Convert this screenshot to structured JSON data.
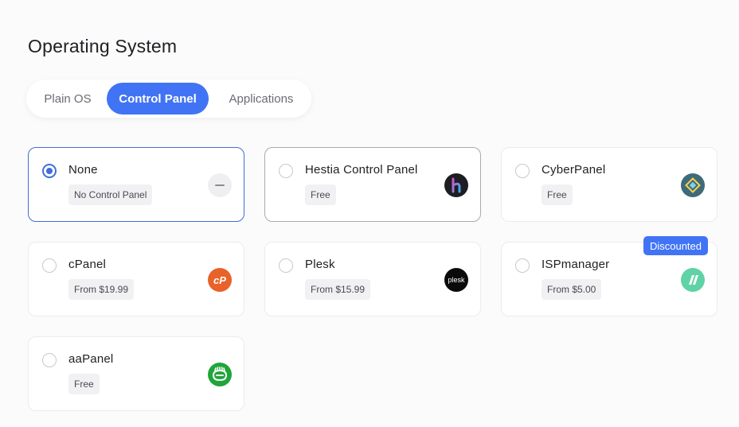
{
  "page_title": "Operating System",
  "tabs": [
    {
      "label": "Plain OS",
      "active": false
    },
    {
      "label": "Control Panel",
      "active": true
    },
    {
      "label": "Applications",
      "active": false
    }
  ],
  "accent_color": "#4174f5",
  "options": [
    {
      "name": "None",
      "price": "No Control Panel",
      "selected": true,
      "icon": "minus-icon"
    },
    {
      "name": "Hestia Control Panel",
      "price": "Free",
      "selected": false,
      "icon": "hestia-logo-icon"
    },
    {
      "name": "CyberPanel",
      "price": "Free",
      "selected": false,
      "icon": "cyberpanel-logo-icon"
    },
    {
      "name": "cPanel",
      "price": "From $19.99",
      "selected": false,
      "icon": "cpanel-logo-icon",
      "logo_text": "cP"
    },
    {
      "name": "Plesk",
      "price": "From $15.99",
      "selected": false,
      "icon": "plesk-logo-icon",
      "logo_text": "plesk"
    },
    {
      "name": "ISPmanager",
      "price": "From $5.00",
      "selected": false,
      "icon": "ispmanager-logo-icon",
      "badge": "Discounted"
    },
    {
      "name": "aaPanel",
      "price": "Free",
      "selected": false,
      "icon": "aapanel-logo-icon"
    }
  ]
}
